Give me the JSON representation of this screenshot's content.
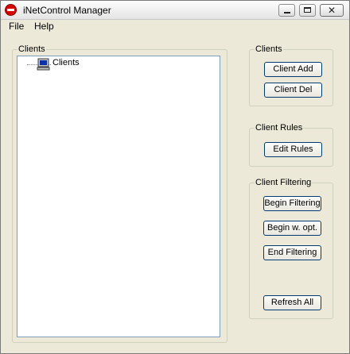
{
  "window": {
    "title": "iNetControl Manager"
  },
  "menu": {
    "file": "File",
    "help": "Help"
  },
  "clients_panel": {
    "legend": "Clients",
    "tree_root": "Clients"
  },
  "clients_group": {
    "legend": "Clients",
    "add_label": "Client Add",
    "del_label": "Client Del"
  },
  "rules_group": {
    "legend": "Client Rules",
    "edit_label": "Edit Rules"
  },
  "filter_group": {
    "legend": "Client Filtering",
    "begin_label": "Begin Filtering",
    "begin_opt_label": "Begin w. opt.",
    "end_label": "End Filtering",
    "refresh_label": "Refresh All"
  }
}
